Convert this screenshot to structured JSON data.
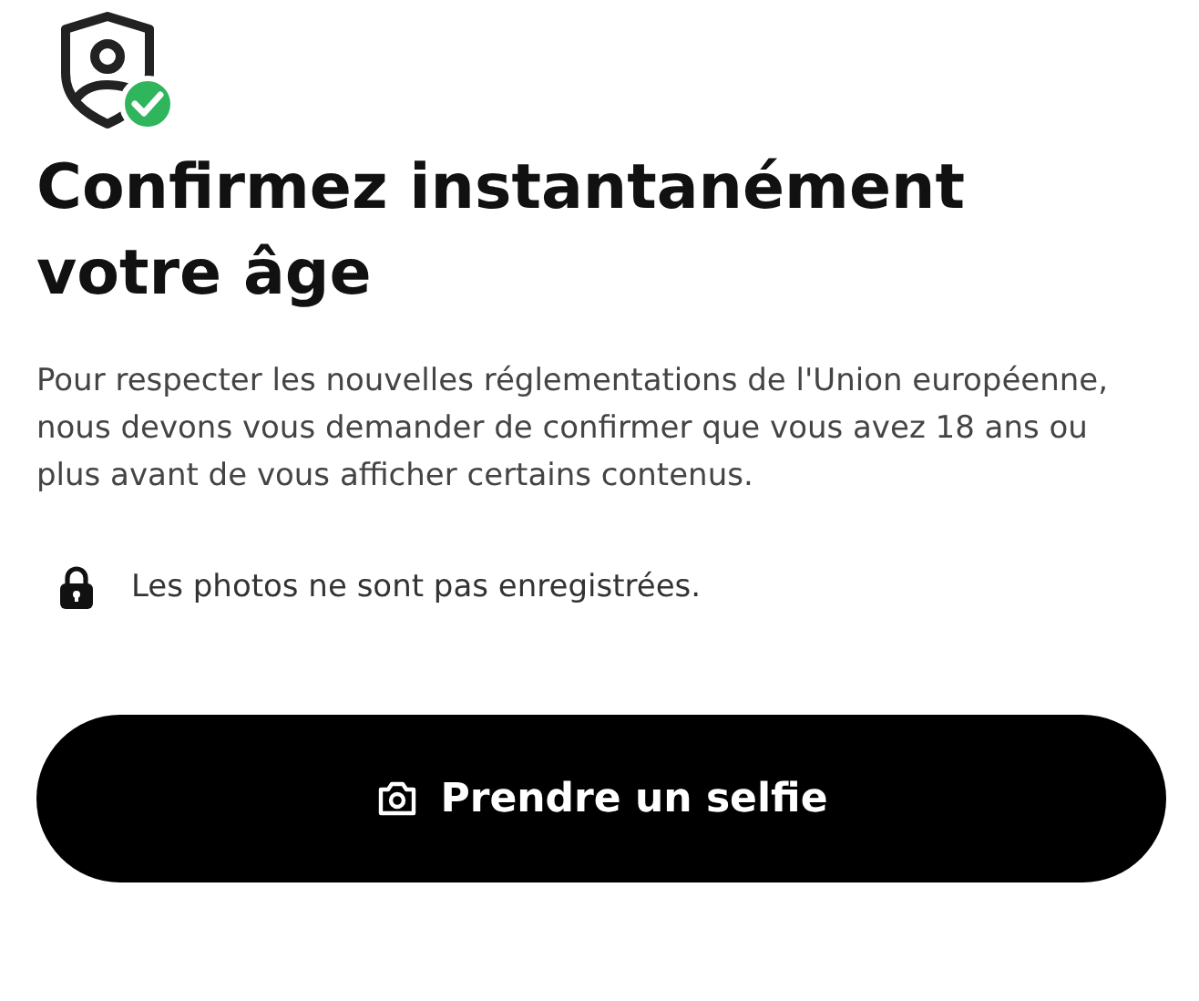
{
  "title": "Confirmez instantanément votre âge",
  "description": "Pour respecter les nouvelles réglementations de l'Union européenne, nous devons vous demander de confirmer que vous avez 18 ans ou plus avant de vous afficher certains contenus.",
  "privacy_note": "Les photos ne sont pas enregistrées.",
  "button": {
    "label": "Prendre un selfie"
  }
}
